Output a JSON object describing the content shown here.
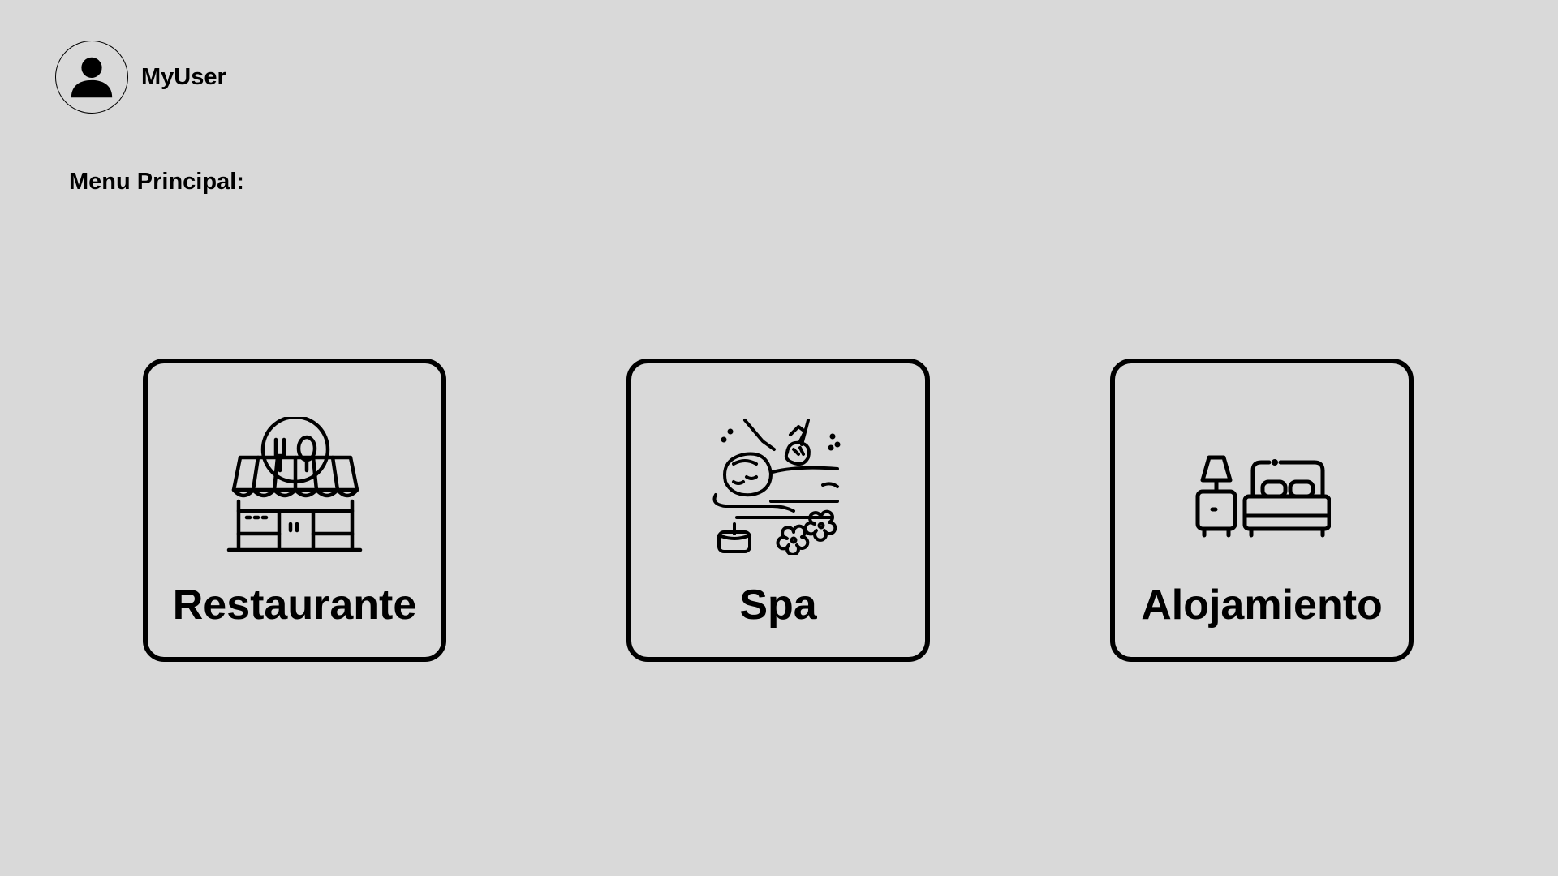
{
  "user": {
    "name": "MyUser",
    "avatar_icon": "user-avatar-icon"
  },
  "menu": {
    "title": "Menu Principal:"
  },
  "cards": [
    {
      "label": "Restaurante",
      "icon": "restaurant-storefront-icon"
    },
    {
      "label": "Spa",
      "icon": "spa-massage-icon"
    },
    {
      "label": "Alojamiento",
      "icon": "bed-lamp-icon"
    }
  ],
  "colors": {
    "background": "#d9d9d9",
    "foreground": "#000000"
  }
}
